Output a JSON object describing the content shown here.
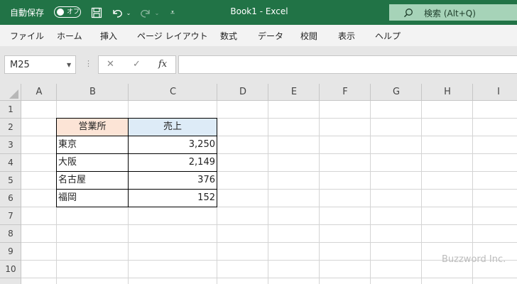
{
  "titlebar": {
    "autosave_label": "自動保存",
    "autosave_state": "オフ",
    "document_title": "Book1  -  Excel",
    "search_placeholder": "検索 (Alt+Q)"
  },
  "menu": [
    "ファイル",
    "ホーム",
    "挿入",
    "ページ レイアウト",
    "数式",
    "データ",
    "校閲",
    "表示",
    "ヘルプ"
  ],
  "formula_bar": {
    "name_box": "M25",
    "cancel_symbol": "✕",
    "enter_symbol": "✓",
    "fx_label": "fx",
    "formula": ""
  },
  "sheet": {
    "columns": [
      "A",
      "B",
      "C",
      "D",
      "E",
      "F",
      "G",
      "H",
      "I"
    ],
    "rows": [
      "1",
      "2",
      "3",
      "4",
      "5",
      "6",
      "7",
      "8",
      "9",
      "10"
    ],
    "table": {
      "header": {
        "office": "営業所",
        "sales": "売上"
      },
      "rows": [
        {
          "office": "東京",
          "sales": "3,250"
        },
        {
          "office": "大阪",
          "sales": "2,149"
        },
        {
          "office": "名古屋",
          "sales": "376"
        },
        {
          "office": "福岡",
          "sales": "152"
        }
      ],
      "header_colors": {
        "office": "#fce4d6",
        "sales": "#ddebf7"
      }
    }
  },
  "watermark": "Buzzword Inc.",
  "colors": {
    "excel_green": "#217346",
    "search_bg": "#a6d3b8",
    "header_bg": "#e6e6e6",
    "selected_header": "#d2d2d2"
  }
}
